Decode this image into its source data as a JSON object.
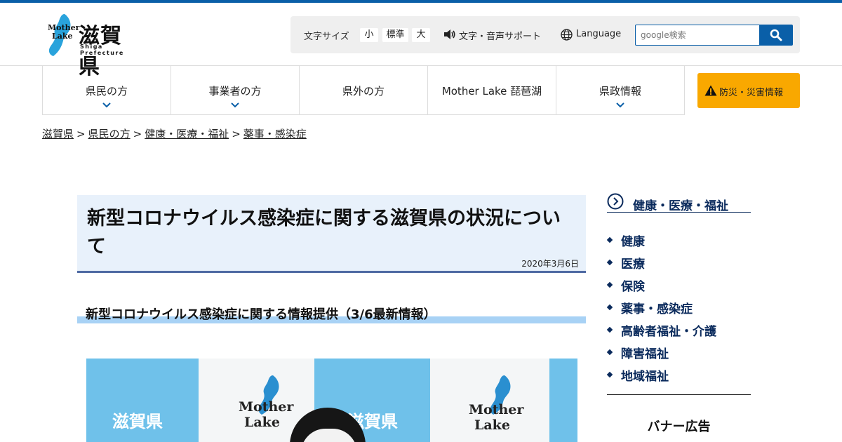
{
  "header": {
    "logo": {
      "prefecture": "滋賀県",
      "mother_lake_line1": "Mother",
      "mother_lake_line2": "Lake",
      "subtitle": "Shiga Prefecture"
    },
    "toolbox": {
      "font_size_label": "文字サイズ",
      "size_small": "小",
      "size_medium": "標準",
      "size_large": "大",
      "voice_support": "文字・音声サポート",
      "language": "Language",
      "search_placeholder": "google検索"
    }
  },
  "gnav": {
    "items": [
      {
        "label": "県民の方"
      },
      {
        "label": "事業者の方"
      },
      {
        "label": "県外の方"
      },
      {
        "label": "Mother Lake 琵琶湖"
      },
      {
        "label": "県政情報"
      }
    ],
    "disaster": "防災・災害情報"
  },
  "breadcrumb": {
    "items": [
      "滋賀県",
      "県民の方",
      "健康・医療・福祉",
      "薬事・感染症"
    ],
    "separator": ">"
  },
  "article": {
    "title": "新型コロナウイルス感染症に関する滋賀県の状況について",
    "date": "2020年3月6日",
    "subheading": "新型コロナウイルス感染症に関する情報提供（3/6最新情報）"
  },
  "photo": {
    "backdrop_texts": [
      "滋賀県",
      "滋賀県"
    ],
    "backdrop_ml": [
      "Mother",
      "Lake"
    ]
  },
  "sidebar": {
    "heading": "健康・医療・福祉",
    "items": [
      "健康",
      "医療",
      "保険",
      "薬事・感染症",
      "高齢者福祉・介護",
      "障害福祉",
      "地域福祉"
    ],
    "banner_title": "バナー広告"
  },
  "colors": {
    "brand_blue": "#0a5fa8",
    "navy": "#0a2a5c",
    "disaster_yellow": "#f9a800",
    "title_bg": "#e8f1fb",
    "subheading_bar": "#a8d2f5"
  }
}
